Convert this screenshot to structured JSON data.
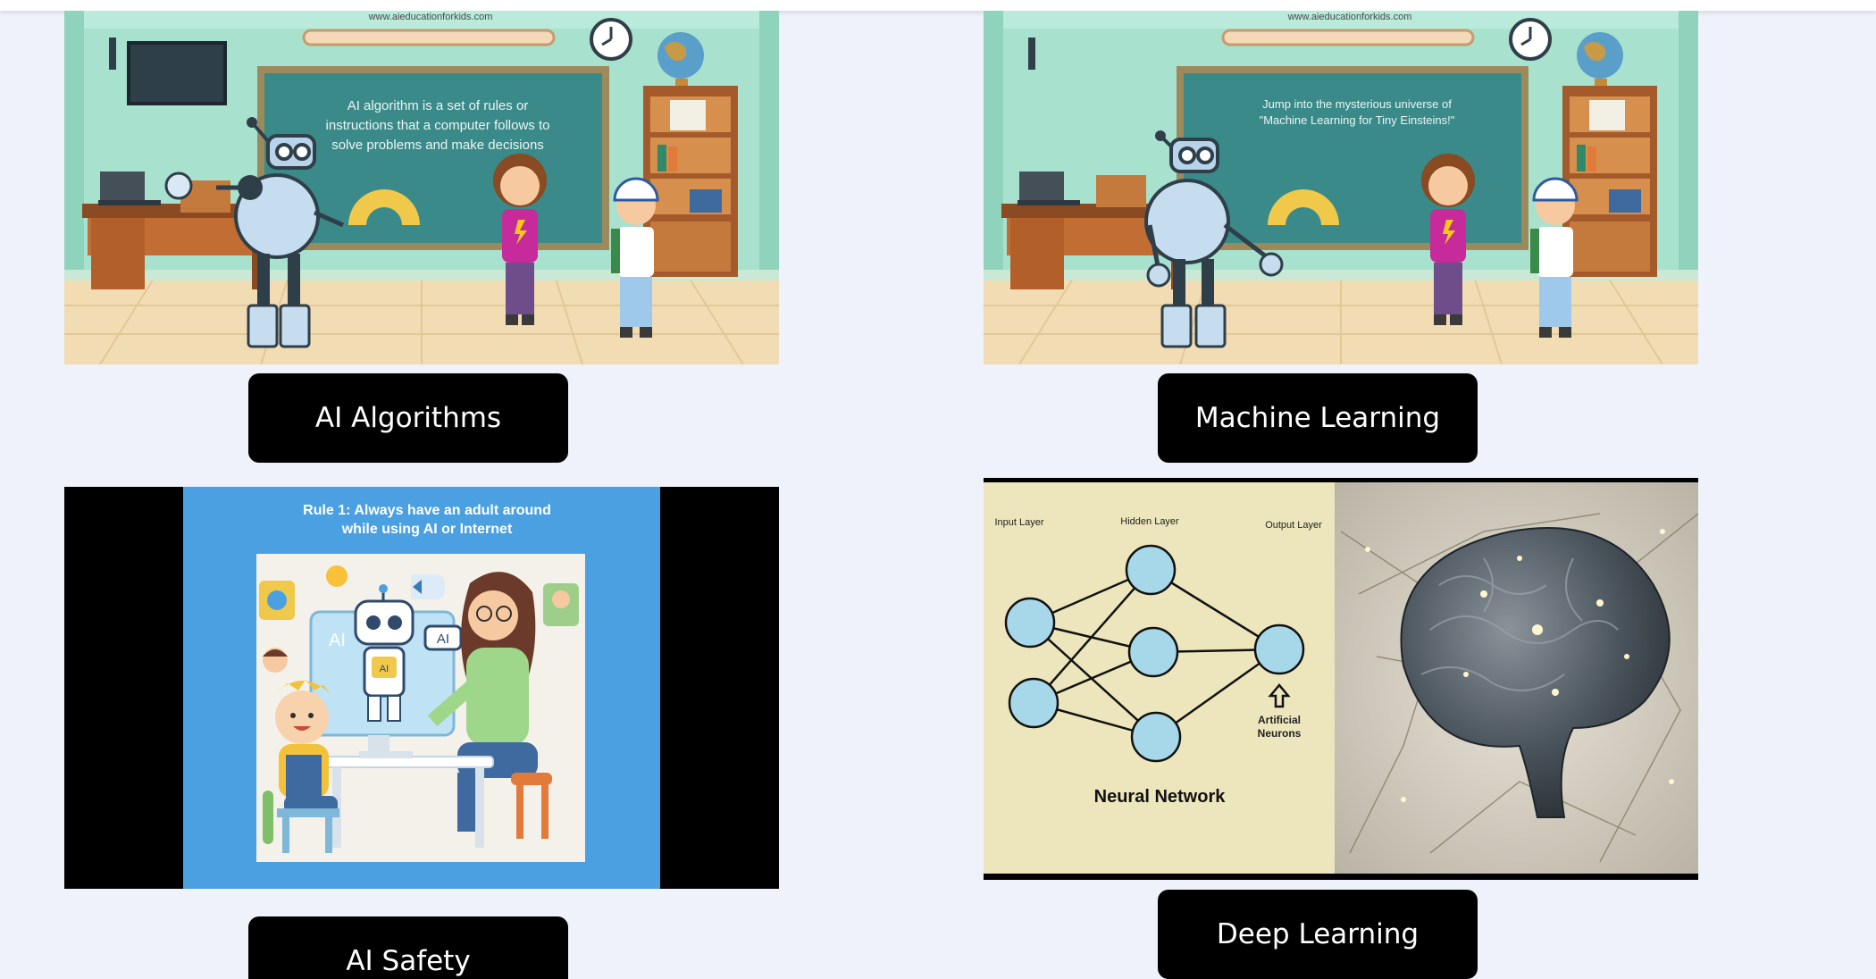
{
  "cards": [
    {
      "label": "AI Algorithms",
      "image": {
        "site_url": "www.aieducationforkids.com",
        "board_lines": [
          "AI algorithm is a set of rules or",
          "instructions that a computer follows to",
          "solve problems and make decisions"
        ]
      }
    },
    {
      "label": "Machine Learning",
      "image": {
        "site_url": "www.aieducationforkids.com",
        "board_lines": [
          "Jump into the mysterious universe of",
          "\"Machine Learning for Tiny Einsteins!\""
        ]
      }
    },
    {
      "label": "AI Safety",
      "image": {
        "title_lines": [
          "Rule 1: Always have an adult around",
          "while using AI or Internet"
        ],
        "screen_text": "AI",
        "bubble_text": "AI",
        "robot_chest": "AI"
      }
    },
    {
      "label": "Deep Learning",
      "image": {
        "input_layer": "Input Layer",
        "hidden_layer": "Hidden Layer",
        "output_layer": "Output Layer",
        "neurons_lines": [
          "Artificial",
          "Neurons"
        ],
        "caption": "Neural Network"
      }
    }
  ],
  "colors": {
    "page_bg": "#eff2fb",
    "button_bg": "#000000",
    "button_text": "#ffffff",
    "classroom_wall": "#a8e2cf",
    "chalkboard": "#3a8a8a",
    "safety_blue": "#4aa0e0",
    "neuron_fill": "#a6d8ea",
    "diagram_bg": "#ede6bc"
  }
}
